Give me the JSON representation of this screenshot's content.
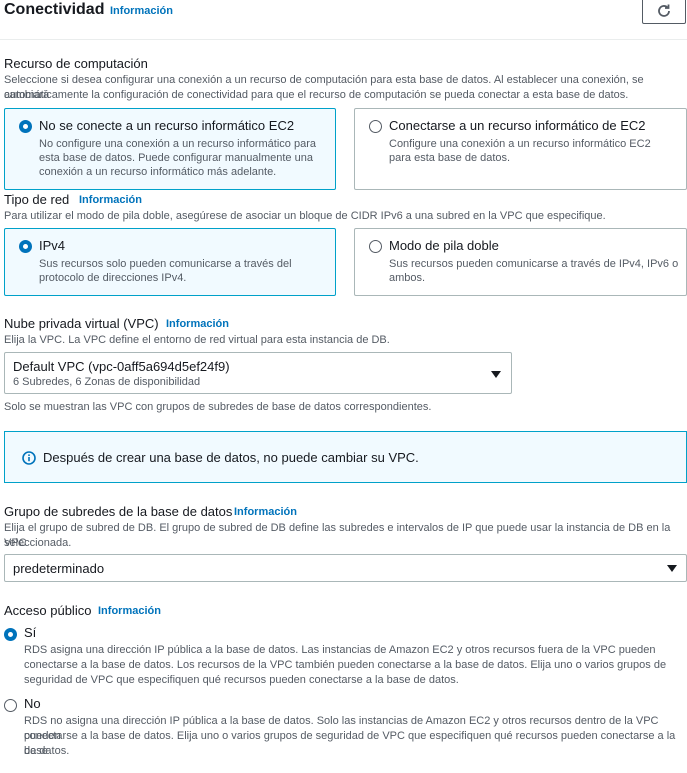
{
  "header": {
    "title": "Conectividad",
    "info": "Información"
  },
  "compute": {
    "label": "Recurso de computación",
    "description_line1": "Seleccione si desea configurar una conexión a un recurso de computación para esta base de datos. Al establecer una conexión, se cambiará",
    "description_line2": "automáticamente la configuración de conectividad para que el recurso de computación se pueda conectar a esta base de datos.",
    "options": [
      {
        "title": "No se conecte a un recurso informático EC2",
        "desc_lines": [
          "No configure una conexión a un recurso informático para",
          "esta base de datos. Puede configurar manualmente una",
          "conexión a un recurso informático más adelante."
        ],
        "selected": true
      },
      {
        "title": "Conectarse a un recurso informático de EC2",
        "desc_lines": [
          "Configure una conexión a un recurso informático EC2",
          "para esta base de datos."
        ],
        "selected": false
      }
    ]
  },
  "network": {
    "label": "Tipo de red",
    "info": "Información",
    "description": "Para utilizar el modo de pila doble, asegúrese de asociar un bloque de CIDR IPv6 a una subred en la VPC que especifique.",
    "options": [
      {
        "title": "IPv4",
        "desc_lines": [
          "Sus recursos solo pueden comunicarse a través del",
          "protocolo de direcciones IPv4."
        ],
        "selected": true
      },
      {
        "title": "Modo de pila doble",
        "desc_lines": [
          "Sus recursos pueden comunicarse a través de IPv4, IPv6 o",
          "ambos."
        ],
        "selected": false
      }
    ]
  },
  "vpc": {
    "label": "Nube privada virtual (VPC)",
    "info": "Información",
    "description": "Elija la VPC. La VPC define el entorno de red virtual para esta instancia de DB.",
    "selected_value": "Default VPC (vpc-0aff5a694d5ef24f9)",
    "selected_sub": "6 Subredes, 6 Zonas de disponibilidad",
    "hint": "Solo se muestran las VPC con grupos de subredes de base de datos correspondientes."
  },
  "alert": {
    "text": "Después de crear una base de datos, no puede cambiar su VPC."
  },
  "subnet": {
    "label": "Grupo de subredes de la base de datos",
    "info": "Información",
    "description_line1": "Elija el grupo de subred de DB. El grupo de subred de DB define las subredes e intervalos de IP que puede usar la instancia de DB en la VPC",
    "description_line2": "seleccionada.",
    "selected_value": "predeterminado"
  },
  "public_access": {
    "label": "Acceso público",
    "info": "Información",
    "options": [
      {
        "title": "Sí",
        "desc_lines": [
          "RDS asigna una dirección IP pública a la base de datos. Las instancias de Amazon EC2 y otros recursos fuera de la VPC pueden",
          "conectarse a la base de datos. Los recursos de la VPC también pueden conectarse a la base de datos. Elija uno o varios grupos de",
          "seguridad de VPC que especifiquen qué recursos pueden conectarse a la base de datos."
        ],
        "selected": true
      },
      {
        "title": "No",
        "desc_lines": [
          "RDS no asigna una dirección IP pública a la base de datos. Solo las instancias de Amazon EC2 y otros recursos dentro de la VPC pueden",
          "conectarse a la base de datos. Elija uno o varios grupos de seguridad de VPC que especifiquen qué recursos pueden conectarse a la base",
          "de datos."
        ],
        "selected": false
      }
    ]
  },
  "colors": {
    "accent": "#0073bb",
    "selected_border": "#00a1c9",
    "selected_bg": "#f1faff"
  }
}
